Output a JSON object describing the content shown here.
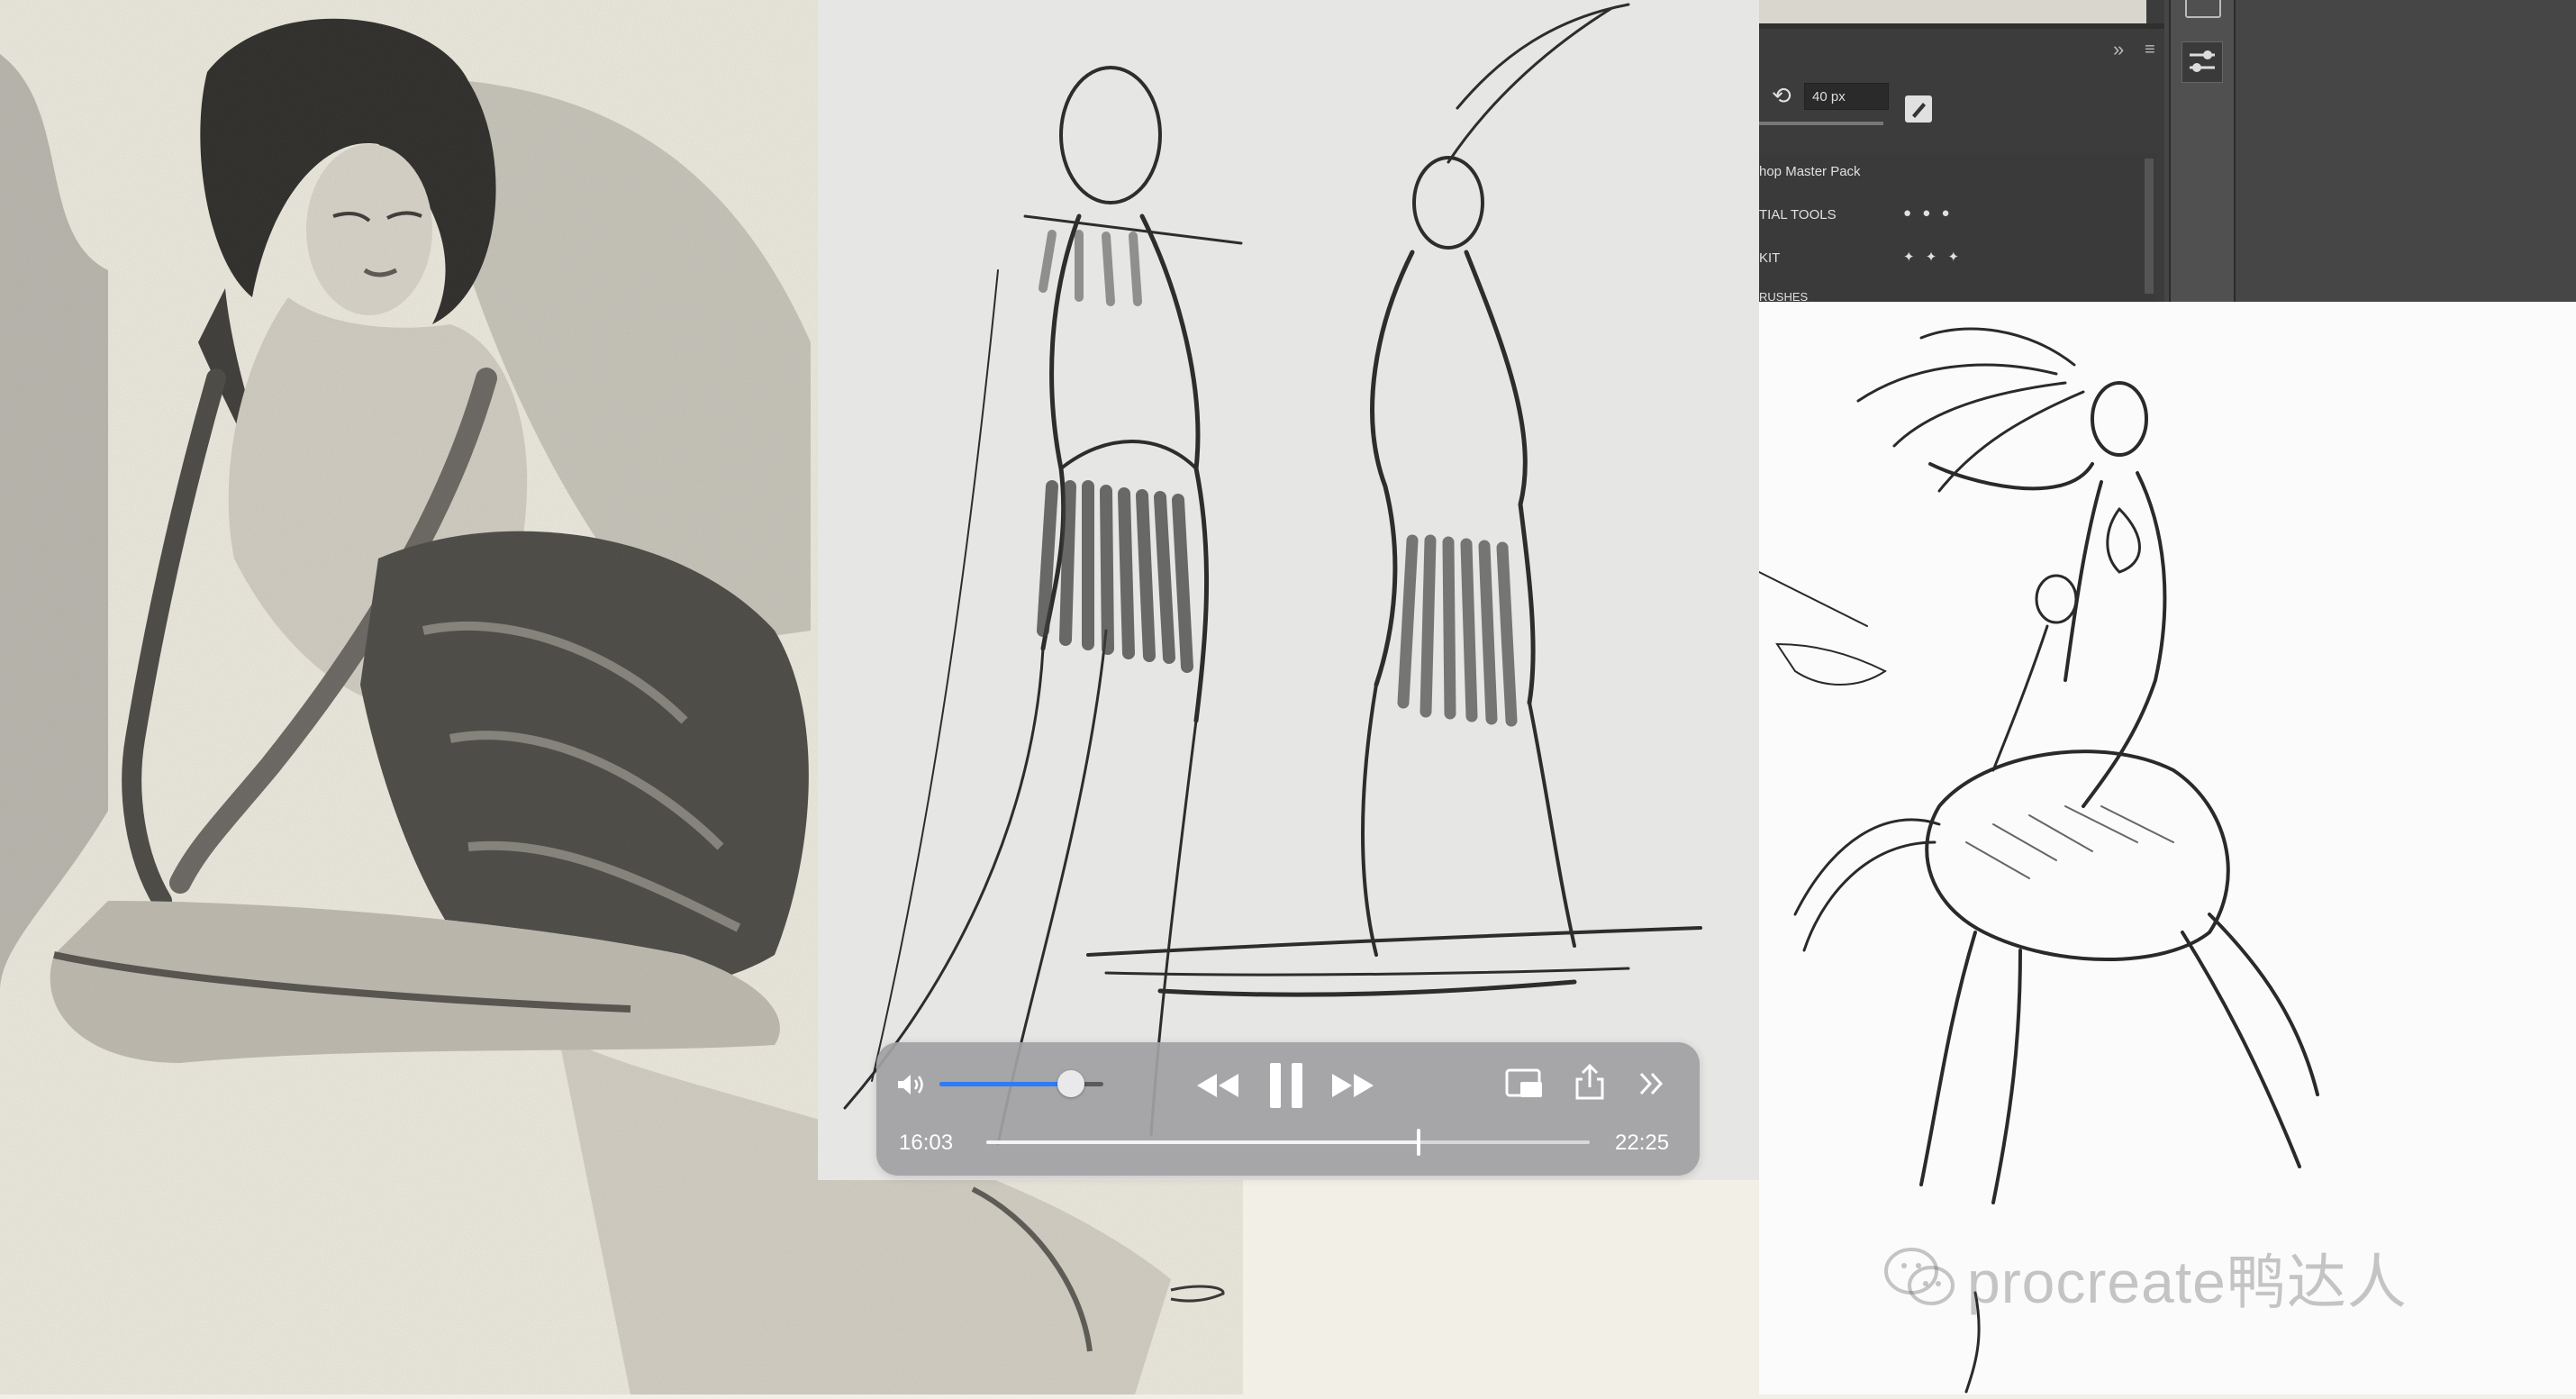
{
  "player": {
    "current_time": "16:03",
    "total_time": "22:25",
    "progress": 0.716,
    "volume": 0.8,
    "state": "playing",
    "accent_color": "#2f7bf5",
    "icons": [
      "volume-icon",
      "rewind-icon",
      "pause-icon",
      "fast-forward-icon",
      "picture-in-picture-icon",
      "share-icon",
      "more-chevrons-icon"
    ]
  },
  "photoshop_panel": {
    "brush_size": "40 px",
    "list_items": [
      {
        "label": "hop Master Pack",
        "marker": ""
      },
      {
        "label": "TIAL TOOLS",
        "marker": "● ● ●"
      },
      {
        "label": "KIT",
        "marker": "✦ ✦ ✦"
      },
      {
        "label": "RUSHES",
        "marker": ""
      }
    ]
  },
  "watermark": {
    "text": "procreate鸭达人",
    "icon": "wechat-icon"
  }
}
